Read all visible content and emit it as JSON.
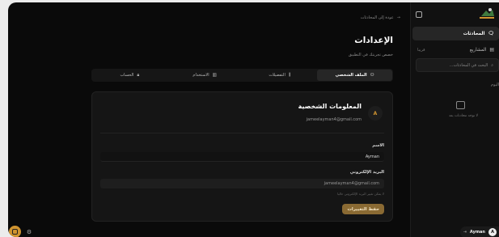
{
  "sidebar": {
    "items": [
      {
        "label": "المحادثات",
        "icon": "chat-icon"
      },
      {
        "label": "المشاريع",
        "icon": "folder-icon",
        "badge": "قريبا"
      }
    ],
    "search_placeholder": "البحث في المحادثات...",
    "section_label": "اليوم",
    "empty_text": "لا توجد محادثات بعد",
    "user": {
      "initial": "A",
      "name": "Ayman"
    }
  },
  "main": {
    "back_label": "عودة إلى المحادثات",
    "title": "الإعدادات",
    "subtitle": "خصص تجربتك في التطبيق",
    "tabs": [
      {
        "label": "الملف الشخصي",
        "icon": "user-icon",
        "active": true
      },
      {
        "label": "التفضيلات",
        "icon": "sliders-icon",
        "active": false
      },
      {
        "label": "الاستخدام",
        "icon": "chart-icon",
        "active": false
      },
      {
        "label": "الحساب",
        "icon": "lock-icon",
        "active": false
      }
    ],
    "profile": {
      "avatar_initial": "A",
      "title": "المعلومات الشخصية",
      "email": "jameelayman4@gmail.com",
      "name_label": "الاسم",
      "name_value": "Ayman",
      "email_label": "البريد الإلكتروني",
      "email_value": "jameelayman4@gmail.com",
      "email_hint": "لا يمكن تغيير البريد الإلكتروني حاليا",
      "save_label": "حفظ التغييرات"
    }
  },
  "colors": {
    "accent": "#d09430",
    "save_bg": "#8a6a33",
    "bg": "#0a0a0a"
  }
}
